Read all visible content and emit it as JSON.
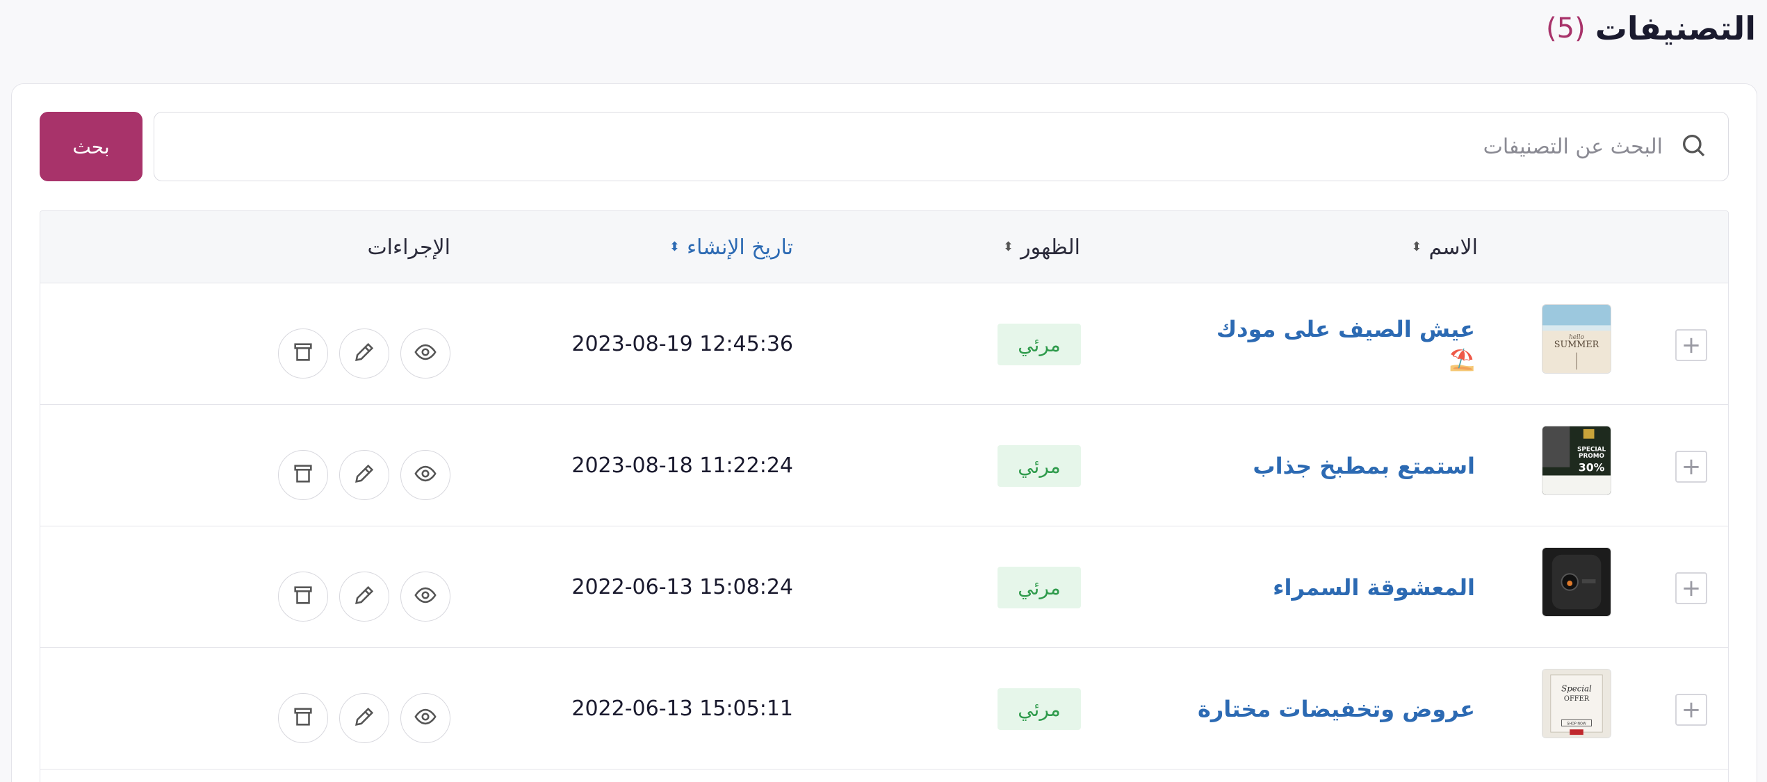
{
  "header": {
    "title": "التصنيفات",
    "count": "(5)"
  },
  "search": {
    "placeholder": "البحث عن التصنيفات",
    "button_label": "بحث"
  },
  "table": {
    "columns": {
      "name": "الاسم",
      "visibility": "الظهور",
      "created": "تاريخ الإنشاء",
      "actions": "الإجراءات"
    },
    "sorted_column": "created",
    "rows": [
      {
        "name": "عيش الصيف على مودك",
        "emoji": "⛱️",
        "visibility": "مرئي",
        "created": "2023-08-19 12:45:36",
        "thumb": "hello-summer"
      },
      {
        "name": "استمتع بمطبخ جذاب",
        "emoji": "",
        "visibility": "مرئي",
        "created": "2023-08-18 11:22:24",
        "thumb": "special-promo"
      },
      {
        "name": "المعشوقة السمراء",
        "emoji": "",
        "visibility": "مرئي",
        "created": "2022-06-13 15:08:24",
        "thumb": "coffee-machine"
      },
      {
        "name": "عروض وتخفيضات مختارة",
        "emoji": "",
        "visibility": "مرئي",
        "created": "2022-06-13 15:05:11",
        "thumb": "special-offer"
      }
    ]
  },
  "thumb_text": {
    "summer_small": "hello",
    "summer_big": "SUMMER",
    "promo_1": "SPECIAL",
    "promo_2": "PROMO",
    "promo_3": "30%",
    "offer_1": "Special",
    "offer_2": "OFFER",
    "offer_3": "SHOP NOW"
  },
  "colors": {
    "accent": "#a8336a",
    "link": "#2c6ab3",
    "badge_bg": "#e6f6ea",
    "badge_text": "#2f9b4c"
  }
}
